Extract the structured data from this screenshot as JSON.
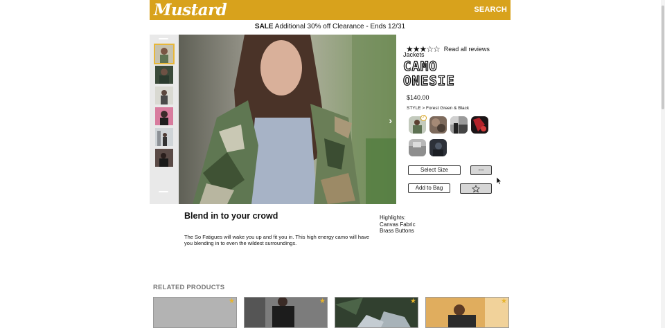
{
  "header": {
    "logo": "Mustard",
    "search_label": "SEARCH"
  },
  "sale": {
    "label": "SALE",
    "text": " Additional 30% off Clearance - Ends 12/31"
  },
  "product": {
    "rating": 3.5,
    "stars_text": "★★★☆☆",
    "reviews_link": "Read all reviews",
    "category": "Jackets",
    "title_line1": "CAMO",
    "title_line2": "ONESIE",
    "price": "$140.00",
    "style_label": "STYLE > Forest Green & Black",
    "select_size_label": "Select Size",
    "quantity_label": "---",
    "add_to_bag_label": "Add to Bag",
    "favorite_icon": "star-outline-icon"
  },
  "gallery": {
    "next_icon": "chevron-right-icon",
    "next_glyph": "›"
  },
  "description": {
    "heading": "Blend in to your crowd",
    "body": "The So Fatigues will wake you up and fit you in. This high energy camo will have you blending in to even the wildest surroundings."
  },
  "highlights": {
    "label": "Highlights:",
    "items": [
      "Canvas Fabric",
      "Brass Buttons"
    ]
  },
  "related": {
    "heading": "RELATED PRODUCTS",
    "star_glyph": "★"
  },
  "colors": {
    "brand": "#d8a21c",
    "star": "#e8b52a"
  }
}
